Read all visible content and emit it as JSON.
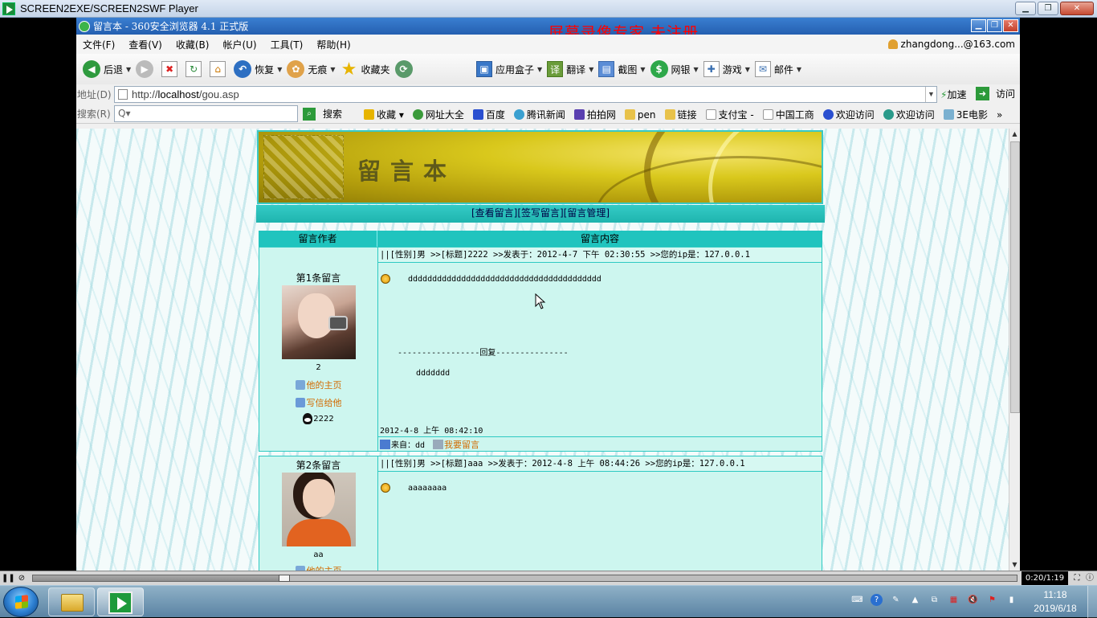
{
  "player": {
    "title": "SCREEN2EXE/SCREEN2SWF Player",
    "time": "0:20/1:19",
    "progress": 0.25
  },
  "browser": {
    "title": "留言本 - 360安全浏览器 4.1 正式版",
    "watermark": "屏幕录像专家  未注册",
    "menu": [
      "文件(F)",
      "查看(V)",
      "收藏(B)",
      "帐户(U)",
      "工具(T)",
      "帮助(H)"
    ],
    "user": "zhangdong...@163.com",
    "toolbar": {
      "back": "后退",
      "restore": "恢复",
      "traceless": "无痕",
      "favorites": "收藏夹",
      "apps": "应用盒子",
      "translate": "翻译",
      "screenshot": "截图",
      "bank": "网银",
      "games": "游戏",
      "mail": "邮件"
    },
    "address": {
      "label": "地址(D)",
      "prefix": "http://",
      "host": "localhost",
      "path": "/gou.asp",
      "accelerate": "加速",
      "go": "访问"
    },
    "search": {
      "label": "搜索(R)",
      "placeholder": "Q▾",
      "button": "搜索"
    },
    "favorites": [
      "收藏 ▾",
      "网址大全",
      "百度",
      "腾讯新闻",
      "拍拍网",
      "pen",
      "链接",
      "支付宝 -",
      "中国工商",
      "欢迎访问",
      "欢迎访问",
      "3E电影",
      "»"
    ]
  },
  "page": {
    "banner_title": "留言本",
    "nav": "[查看留言][签写留言][留言管理]",
    "col_author": "留言作者",
    "col_content": "留言内容",
    "messages": [
      {
        "number": "第1条留言",
        "name": "2",
        "homepage": "他的主页",
        "mail": "写信给他",
        "qq": "2222",
        "header": "||[性别]男  >>[标题]2222  >>发表于：2012-4-7 下午 02:30:55    >>您的ip是：127.0.0.1",
        "body": "dddddddddddddddddddddddddddddddddddddddd",
        "reply_divider": "-----------------回复---------------",
        "reply": "ddddddd",
        "reply_time": "2012-4-8 上午 08:42:10",
        "from": "来自：dd",
        "reply_link": "我要留言"
      },
      {
        "number": "第2条留言",
        "name": "aa",
        "homepage": "他的主页",
        "header": "||[性别]男  >>[标题]aaa  >>发表于：2012-4-8 上午 08:44:26    >>您的ip是：127.0.0.1",
        "body": "aaaaaaaa"
      }
    ]
  },
  "taskbar": {
    "time": "11:18",
    "date": "2019/6/18"
  }
}
